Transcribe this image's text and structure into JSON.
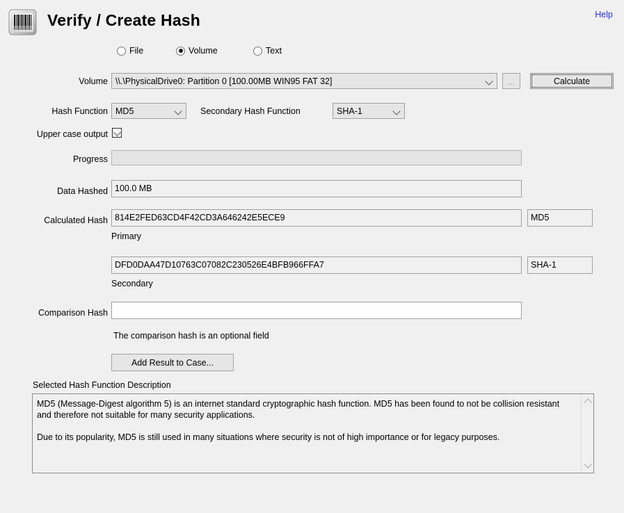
{
  "header": {
    "title": "Verify / Create Hash",
    "icon": "barcode-icon",
    "help_label": "Help"
  },
  "source_mode": {
    "options": [
      {
        "label": "File",
        "selected": false
      },
      {
        "label": "Volume",
        "selected": true
      },
      {
        "label": "Text",
        "selected": false
      }
    ]
  },
  "volume_row": {
    "label": "Volume",
    "value": "\\\\.\\PhysicalDrive0: Partition 0 [100.00MB WIN95 FAT 32]",
    "browse_label": "...",
    "calculate_label": "Calculate"
  },
  "hash_function": {
    "label": "Hash Function",
    "value": "MD5"
  },
  "secondary_hash_function": {
    "label": "Secondary Hash Function",
    "value": "SHA-1"
  },
  "upper_case_output": {
    "label": "Upper case output",
    "checked": true
  },
  "progress": {
    "label": "Progress",
    "value": ""
  },
  "data_hashed": {
    "label": "Data Hashed",
    "value": "100.0 MB"
  },
  "calculated_hash": {
    "label": "Calculated Hash",
    "primary": {
      "value": "814E2FED63CD4F42CD3A646242E5ECE9",
      "algorithm": "MD5",
      "caption": "Primary"
    },
    "secondary": {
      "value": "DFD0DAA47D10763C07082C230526E4BFB966FFA7",
      "algorithm": "SHA-1",
      "caption": "Secondary"
    }
  },
  "comparison_hash": {
    "label": "Comparison Hash",
    "value": "",
    "hint": "The comparison hash is an optional field"
  },
  "add_result_button": {
    "label": "Add Result to Case..."
  },
  "description": {
    "label": "Selected Hash Function Description",
    "paragraphs": [
      "MD5 (Message-Digest algorithm 5) is an internet standard cryptographic hash function. MD5 has been found to not be collision resistant and therefore not suitable for many security applications.",
      "Due to its popularity, MD5 is still used in many situations where security is not of high importance or for legacy purposes."
    ]
  },
  "colors": {
    "window_bg": "#f0f0f0",
    "link": "#2a2add",
    "field_bg": "#f0f0f0",
    "disabled_bg": "#e4e4e4",
    "control_bg": "#e6e6e6",
    "border": "#a0a0a0"
  }
}
